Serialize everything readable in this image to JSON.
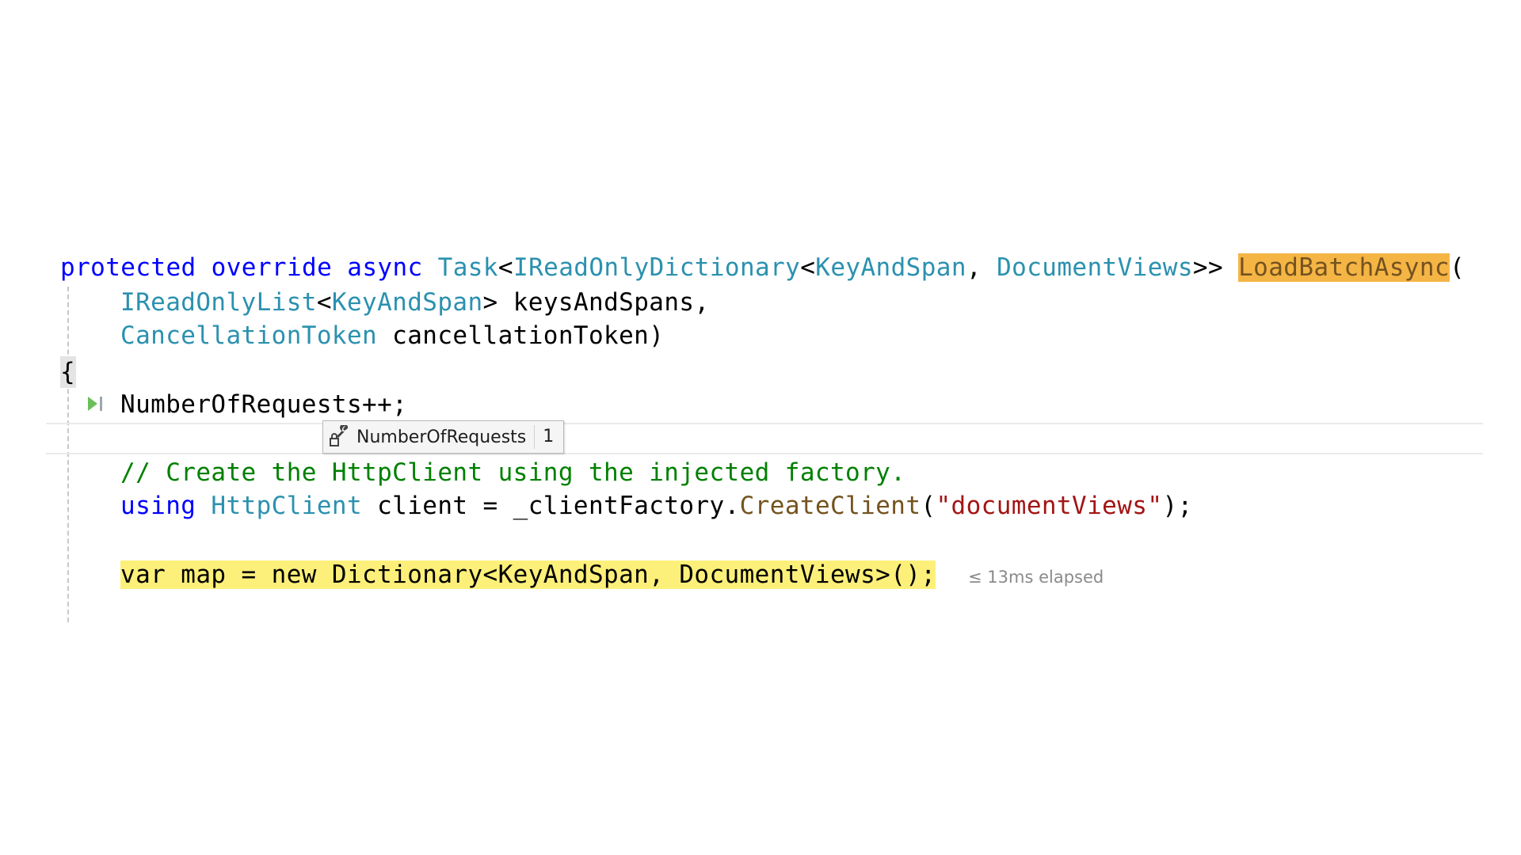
{
  "code": {
    "line1": {
      "protected": "protected",
      "override": "override",
      "async": "async",
      "task": "Task",
      "lt1": "<",
      "ireadonlydictionary": "IReadOnlyDictionary",
      "lt2": "<",
      "keyandspan": "KeyAndSpan",
      "comma": ", ",
      "documentviews": "DocumentViews",
      "gt": ">> ",
      "method": "LoadBatchAsync",
      "paren": "("
    },
    "line2": {
      "type": "IReadOnlyList",
      "lt": "<",
      "arg": "KeyAndSpan",
      "gt": "> ",
      "name": "keysAndSpans,"
    },
    "line3": {
      "type": "CancellationToken",
      "name": " cancellationToken)"
    },
    "line4": {
      "brace": "{"
    },
    "line5": {
      "text": "NumberOfRequests++;"
    },
    "line6": {
      "text": "// Create the HttpClient using the injected factory."
    },
    "line7": {
      "using": "using",
      "type": "HttpClient",
      "mid": " client = _clientFactory.",
      "method": "CreateClient",
      "open": "(",
      "string": "\"documentViews\"",
      "close": ");"
    },
    "line8": {
      "text": "var map = new Dictionary<KeyAndSpan, DocumentViews>();"
    }
  },
  "datatip": {
    "icon": "property-wrench-lock-icon",
    "name": "NumberOfRequests",
    "value": "1"
  },
  "perf_tip": {
    "text": "≤ 13ms elapsed"
  },
  "colors": {
    "keyword": "#0000ff",
    "type": "#2b91af",
    "comment": "#008000",
    "string": "#a31515",
    "method": "#74531f",
    "method_highlight": "#f5b545",
    "current_statement": "#fdf07a"
  }
}
